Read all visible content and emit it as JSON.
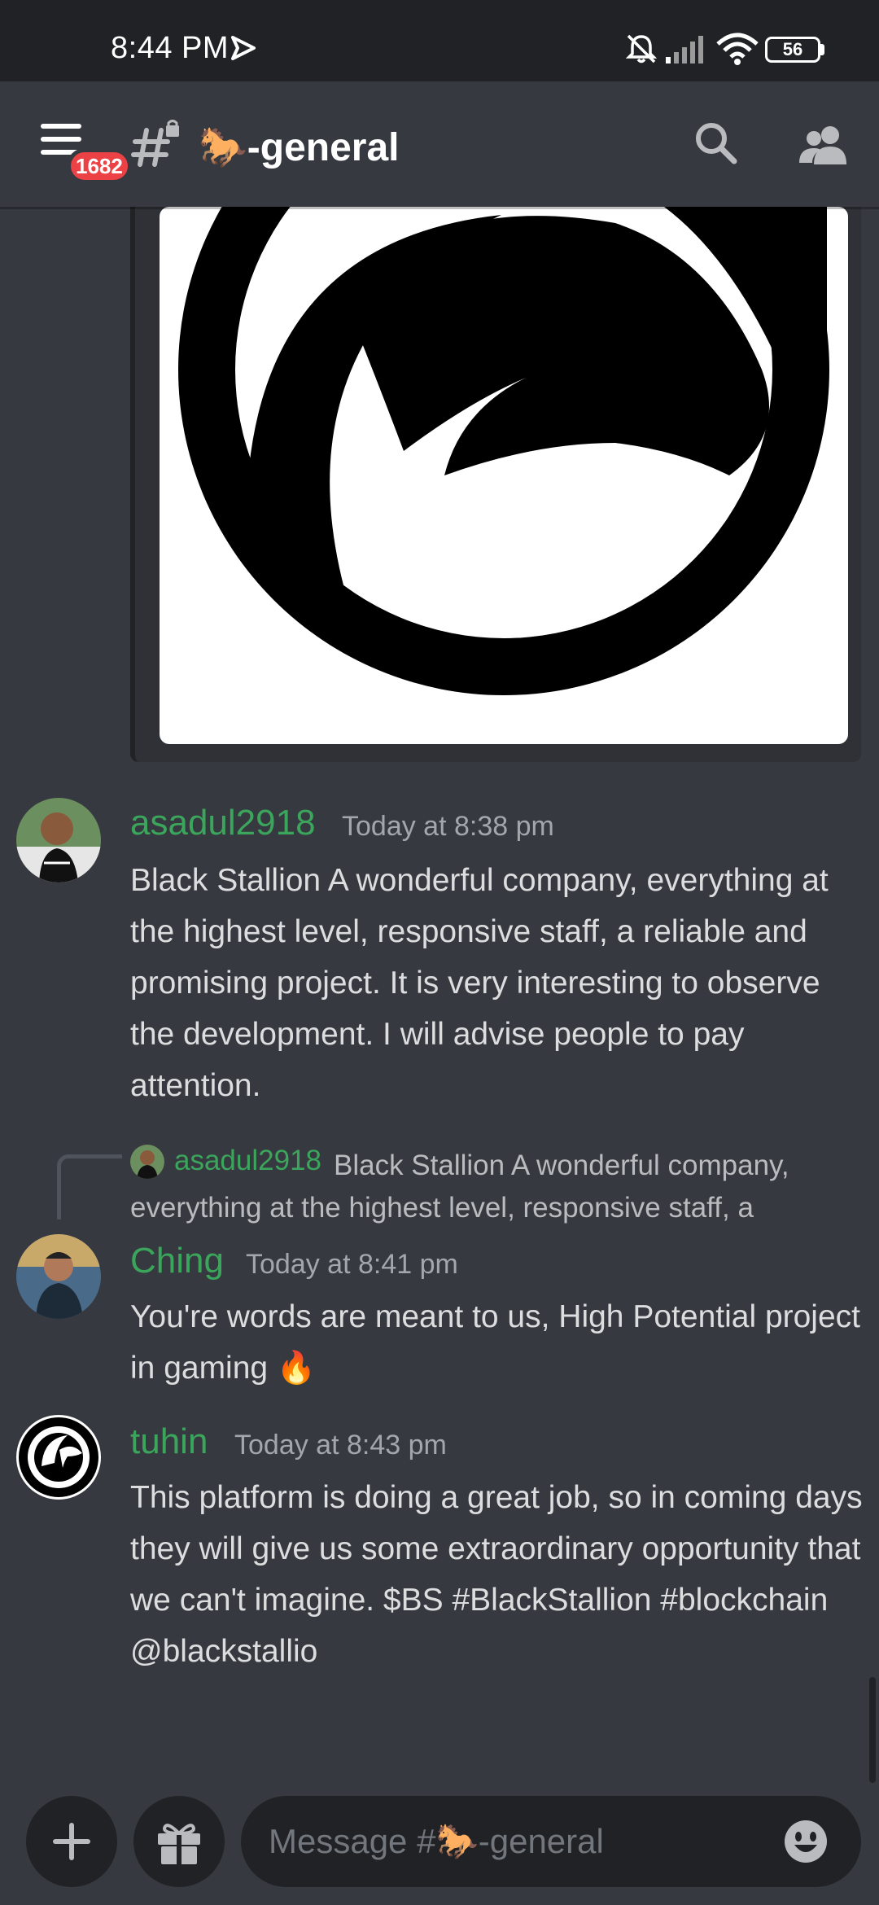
{
  "status_bar": {
    "time": "8:44 PM",
    "battery": "56"
  },
  "header": {
    "unread_badge": "1682",
    "channel_name": "🐎-general",
    "icons": [
      "menu-icon",
      "locked-hash-icon",
      "search-icon",
      "members-icon"
    ]
  },
  "messages": [
    {
      "username": "asadul2918",
      "timestamp": "Today at 8:38 pm",
      "content": "Black Stallion A wonderful company, everything at the highest level, responsive staff, a reliable and promising project. It is very interesting to observe the development. I will advise people to pay attention."
    },
    {
      "reply_to": {
        "username": "asadul2918",
        "content": "Black Stallion A wonderful company, everything at the highest level, responsive staff, a"
      },
      "username": "Ching",
      "timestamp": "Today at 8:41 pm",
      "content": "You're words are meant to us, High Potential project in gaming 🔥"
    },
    {
      "username": "tuhin",
      "timestamp": "Today at 8:43 pm",
      "content": "This platform is doing a great job, so in coming days they will give us some extraordinary opportunity that we can't imagine. $BS #BlackStallion #blockchain @blackstallio"
    }
  ],
  "composer": {
    "placeholder": "Message #🐎-general"
  },
  "colors": {
    "background": "#36393f",
    "status_bar": "#202225",
    "username": "#3ba55c",
    "badge": "#ed4245"
  }
}
